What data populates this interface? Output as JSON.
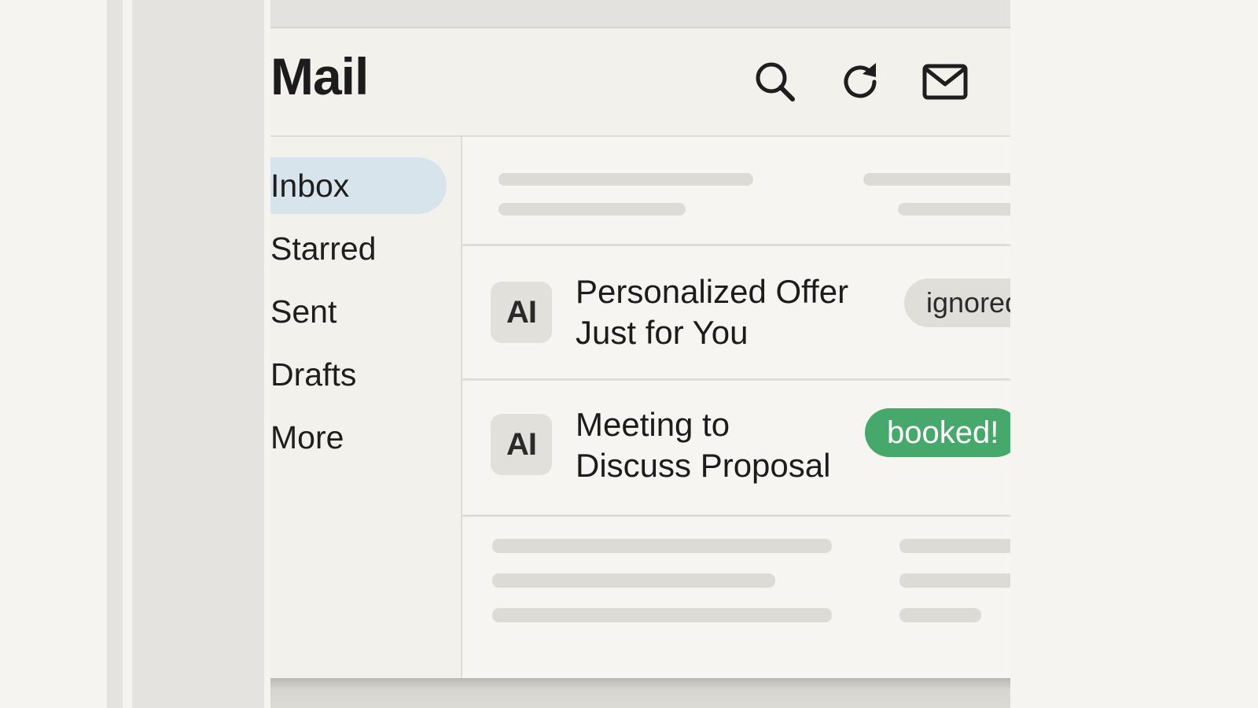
{
  "app": {
    "title": "Mail"
  },
  "header": {
    "icons": [
      "search-icon",
      "refresh-icon",
      "mail-icon"
    ]
  },
  "sidebar": {
    "items": [
      {
        "label": "Inbox",
        "active": true
      },
      {
        "label": "Starred",
        "active": false
      },
      {
        "label": "Sent",
        "active": false
      },
      {
        "label": "Drafts",
        "active": false
      },
      {
        "label": "More",
        "active": false
      }
    ]
  },
  "emails": [
    {
      "avatar": "AI",
      "subject_line1": "Personalized Offer",
      "subject_line2": "Just for You",
      "tag": "ignored"
    },
    {
      "avatar": "AI",
      "subject_line1": "Meeting to",
      "subject_line2": "Discuss Proposal",
      "tag": "booked!"
    }
  ],
  "colors": {
    "active_nav": "#d8e4ec",
    "booked_tag": "#46a86a",
    "ignored_tag": "#e0ded9",
    "background": "#f5f4f0"
  }
}
